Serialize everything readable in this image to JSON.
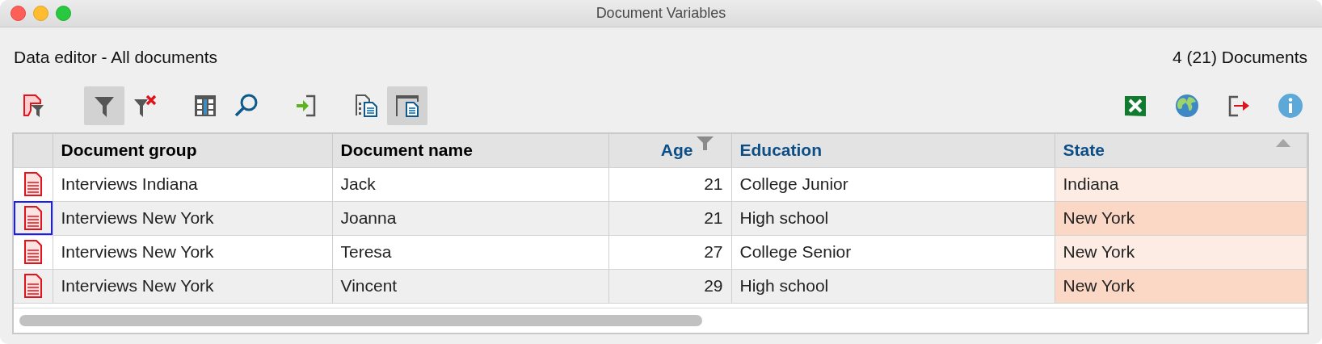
{
  "window": {
    "title": "Document Variables"
  },
  "header": {
    "title": "Data editor - All documents",
    "count": "4 (21) Documents"
  },
  "toolbar": {
    "left_groups": [
      [
        {
          "kind": "document-filter",
          "on": false
        }
      ],
      [
        {
          "kind": "filter",
          "on": true
        },
        {
          "kind": "filter-clear",
          "on": false
        }
      ],
      [
        {
          "kind": "columns",
          "on": false
        },
        {
          "kind": "search",
          "on": false
        }
      ],
      [
        {
          "kind": "import",
          "on": false
        }
      ],
      [
        {
          "kind": "document-list",
          "on": false
        },
        {
          "kind": "document-panel",
          "on": true
        }
      ]
    ],
    "right": [
      {
        "kind": "excel",
        "on": false
      },
      {
        "kind": "globe",
        "on": false
      },
      {
        "kind": "export",
        "on": false
      },
      {
        "kind": "info",
        "on": false
      }
    ]
  },
  "table": {
    "columns": [
      {
        "label": "Document group",
        "kind": "system",
        "right_aligned": false,
        "filtered": false,
        "sorted": false
      },
      {
        "label": "Document name",
        "kind": "system",
        "right_aligned": false,
        "filtered": false,
        "sorted": false
      },
      {
        "label": "Age",
        "kind": "variable",
        "right_aligned": true,
        "filtered": true,
        "sorted": false
      },
      {
        "label": "Education",
        "kind": "variable",
        "right_aligned": false,
        "filtered": false,
        "sorted": false
      },
      {
        "label": "State",
        "kind": "variable",
        "right_aligned": false,
        "filtered": false,
        "sorted": true
      }
    ],
    "rows": [
      {
        "focused": false,
        "cells": [
          "Interviews Indiana",
          "Jack",
          "21",
          "College Junior",
          "Indiana"
        ]
      },
      {
        "focused": true,
        "cells": [
          "Interviews New York",
          "Joanna",
          "21",
          "High school",
          "New York"
        ]
      },
      {
        "focused": false,
        "cells": [
          "Interviews New York",
          "Teresa",
          "27",
          "College Senior",
          "New York"
        ]
      },
      {
        "focused": false,
        "cells": [
          "Interviews New York",
          "Vincent",
          "29",
          "High school",
          "New York"
        ]
      }
    ]
  }
}
